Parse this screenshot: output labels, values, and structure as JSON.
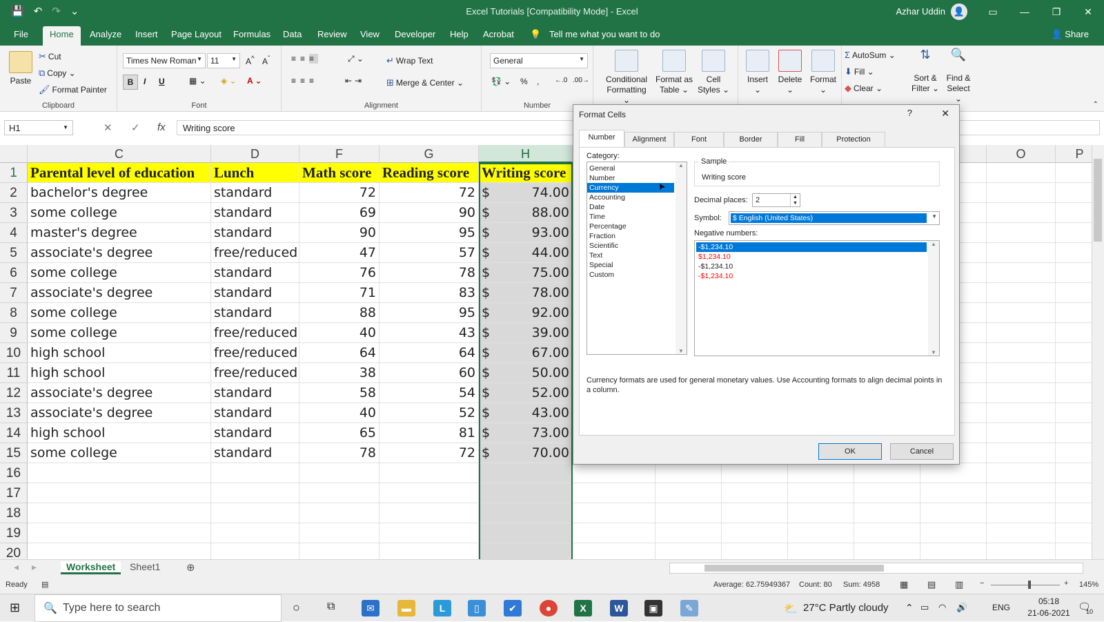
{
  "window": {
    "title": "Excel Tutorials  [Compatibility Mode]  -  Excel",
    "user": "Azhar Uddin",
    "share": "Share"
  },
  "tabs": [
    "File",
    "Home",
    "Analyze",
    "Insert",
    "Page Layout",
    "Formulas",
    "Data",
    "Review",
    "View",
    "Developer",
    "Help",
    "Acrobat"
  ],
  "tell_me": "Tell me what you want to do",
  "ribbon": {
    "clipboard": {
      "label": "Clipboard",
      "paste": "Paste",
      "cut": "Cut",
      "copy": "Copy",
      "format_painter": "Format Painter"
    },
    "font": {
      "label": "Font",
      "name": "Times New Roman",
      "size": "11",
      "bold": "B",
      "italic": "I",
      "underline": "U"
    },
    "alignment": {
      "label": "Alignment",
      "wrap": "Wrap Text",
      "merge": "Merge & Center"
    },
    "number": {
      "label": "Number",
      "format": "General"
    },
    "styles": {
      "conditional": [
        "Conditional",
        "Formatting"
      ],
      "format_table": [
        "Format as",
        "Table"
      ],
      "cell_styles": [
        "Cell",
        "Styles"
      ]
    },
    "cells": {
      "insert": "Insert",
      "delete": "Delete",
      "format": "Format"
    },
    "editing": {
      "autosum": "AutoSum",
      "fill": "Fill",
      "clear": "Clear",
      "sort": [
        "Sort &",
        "Filter"
      ],
      "find": [
        "Find &",
        "Select"
      ]
    }
  },
  "formula_bar": {
    "name_box": "H1",
    "formula": "Writing score",
    "fx": "fx"
  },
  "columns": [
    "C",
    "D",
    "F",
    "G",
    "H",
    "O",
    "P"
  ],
  "rows": [
    {
      "n": "1",
      "c": "Parental level of education",
      "d": "Lunch",
      "f": "Math score",
      "g": "Reading score",
      "h": "Writing score"
    },
    {
      "n": "2",
      "c": "bachelor's degree",
      "d": "standard",
      "f": "72",
      "g": "72",
      "h": "74.00"
    },
    {
      "n": "3",
      "c": "some college",
      "d": "standard",
      "f": "69",
      "g": "90",
      "h": "88.00"
    },
    {
      "n": "4",
      "c": "master's degree",
      "d": "standard",
      "f": "90",
      "g": "95",
      "h": "93.00"
    },
    {
      "n": "5",
      "c": "associate's degree",
      "d": "free/reduced",
      "f": "47",
      "g": "57",
      "h": "44.00"
    },
    {
      "n": "6",
      "c": "some college",
      "d": "standard",
      "f": "76",
      "g": "78",
      "h": "75.00"
    },
    {
      "n": "7",
      "c": "associate's degree",
      "d": "standard",
      "f": "71",
      "g": "83",
      "h": "78.00"
    },
    {
      "n": "8",
      "c": "some college",
      "d": "standard",
      "f": "88",
      "g": "95",
      "h": "92.00"
    },
    {
      "n": "9",
      "c": "some college",
      "d": "free/reduced",
      "f": "40",
      "g": "43",
      "h": "39.00"
    },
    {
      "n": "10",
      "c": "high school",
      "d": "free/reduced",
      "f": "64",
      "g": "64",
      "h": "67.00"
    },
    {
      "n": "11",
      "c": "high school",
      "d": "free/reduced",
      "f": "38",
      "g": "60",
      "h": "50.00"
    },
    {
      "n": "12",
      "c": "associate's degree",
      "d": "standard",
      "f": "58",
      "g": "54",
      "h": "52.00"
    },
    {
      "n": "13",
      "c": "associate's degree",
      "d": "standard",
      "f": "40",
      "g": "52",
      "h": "43.00"
    },
    {
      "n": "14",
      "c": "high school",
      "d": "standard",
      "f": "65",
      "g": "81",
      "h": "73.00"
    },
    {
      "n": "15",
      "c": "some college",
      "d": "standard",
      "f": "78",
      "g": "72",
      "h": "70.00"
    },
    {
      "n": "16",
      "c": "",
      "d": "",
      "f": "",
      "g": "",
      "h": ""
    },
    {
      "n": "17",
      "c": "",
      "d": "",
      "f": "",
      "g": "",
      "h": ""
    },
    {
      "n": "18",
      "c": "",
      "d": "",
      "f": "",
      "g": "",
      "h": ""
    },
    {
      "n": "19",
      "c": "",
      "d": "",
      "f": "",
      "g": "",
      "h": ""
    },
    {
      "n": "20",
      "c": "",
      "d": "",
      "f": "",
      "g": "",
      "h": ""
    }
  ],
  "currency_symbol": "$",
  "sheets": [
    "Worksheet",
    "Sheet1"
  ],
  "status": {
    "ready": "Ready",
    "average": "Average: 62.75949367",
    "count": "Count: 80",
    "sum": "Sum: 4958",
    "zoom": "145%"
  },
  "dialog": {
    "title": "Format Cells",
    "help": "?",
    "close": "✕",
    "tabs": [
      "Number",
      "Alignment",
      "Font",
      "Border",
      "Fill",
      "Protection"
    ],
    "category_label": "Category:",
    "categories": [
      "General",
      "Number",
      "Currency",
      "Accounting",
      "Date",
      "Time",
      "Percentage",
      "Fraction",
      "Scientific",
      "Text",
      "Special",
      "Custom"
    ],
    "selected_category": "Currency",
    "sample_label": "Sample",
    "sample_value": "Writing score",
    "decimal_label": "Decimal places:",
    "decimal_value": "2",
    "symbol_label": "Symbol:",
    "symbol_value": "$ English (United States)",
    "negative_label": "Negative numbers:",
    "negatives": [
      "-$1,234.10",
      "$1,234.10",
      "-$1,234.10",
      "-$1,234.10"
    ],
    "description": "Currency formats are used for general monetary values.  Use Accounting formats to align decimal points in a column.",
    "ok": "OK",
    "cancel": "Cancel"
  },
  "taskbar": {
    "search": "Type here to search",
    "weather": "27°C  Partly cloudy",
    "lang": "ENG",
    "time": "05:18",
    "date": "21-06-2021",
    "notif": "10"
  },
  "colors": {
    "excel_green": "#217346",
    "header_fill": "#ffff00",
    "negative_red": "#ff0000",
    "selection_blue": "#0078d7"
  }
}
